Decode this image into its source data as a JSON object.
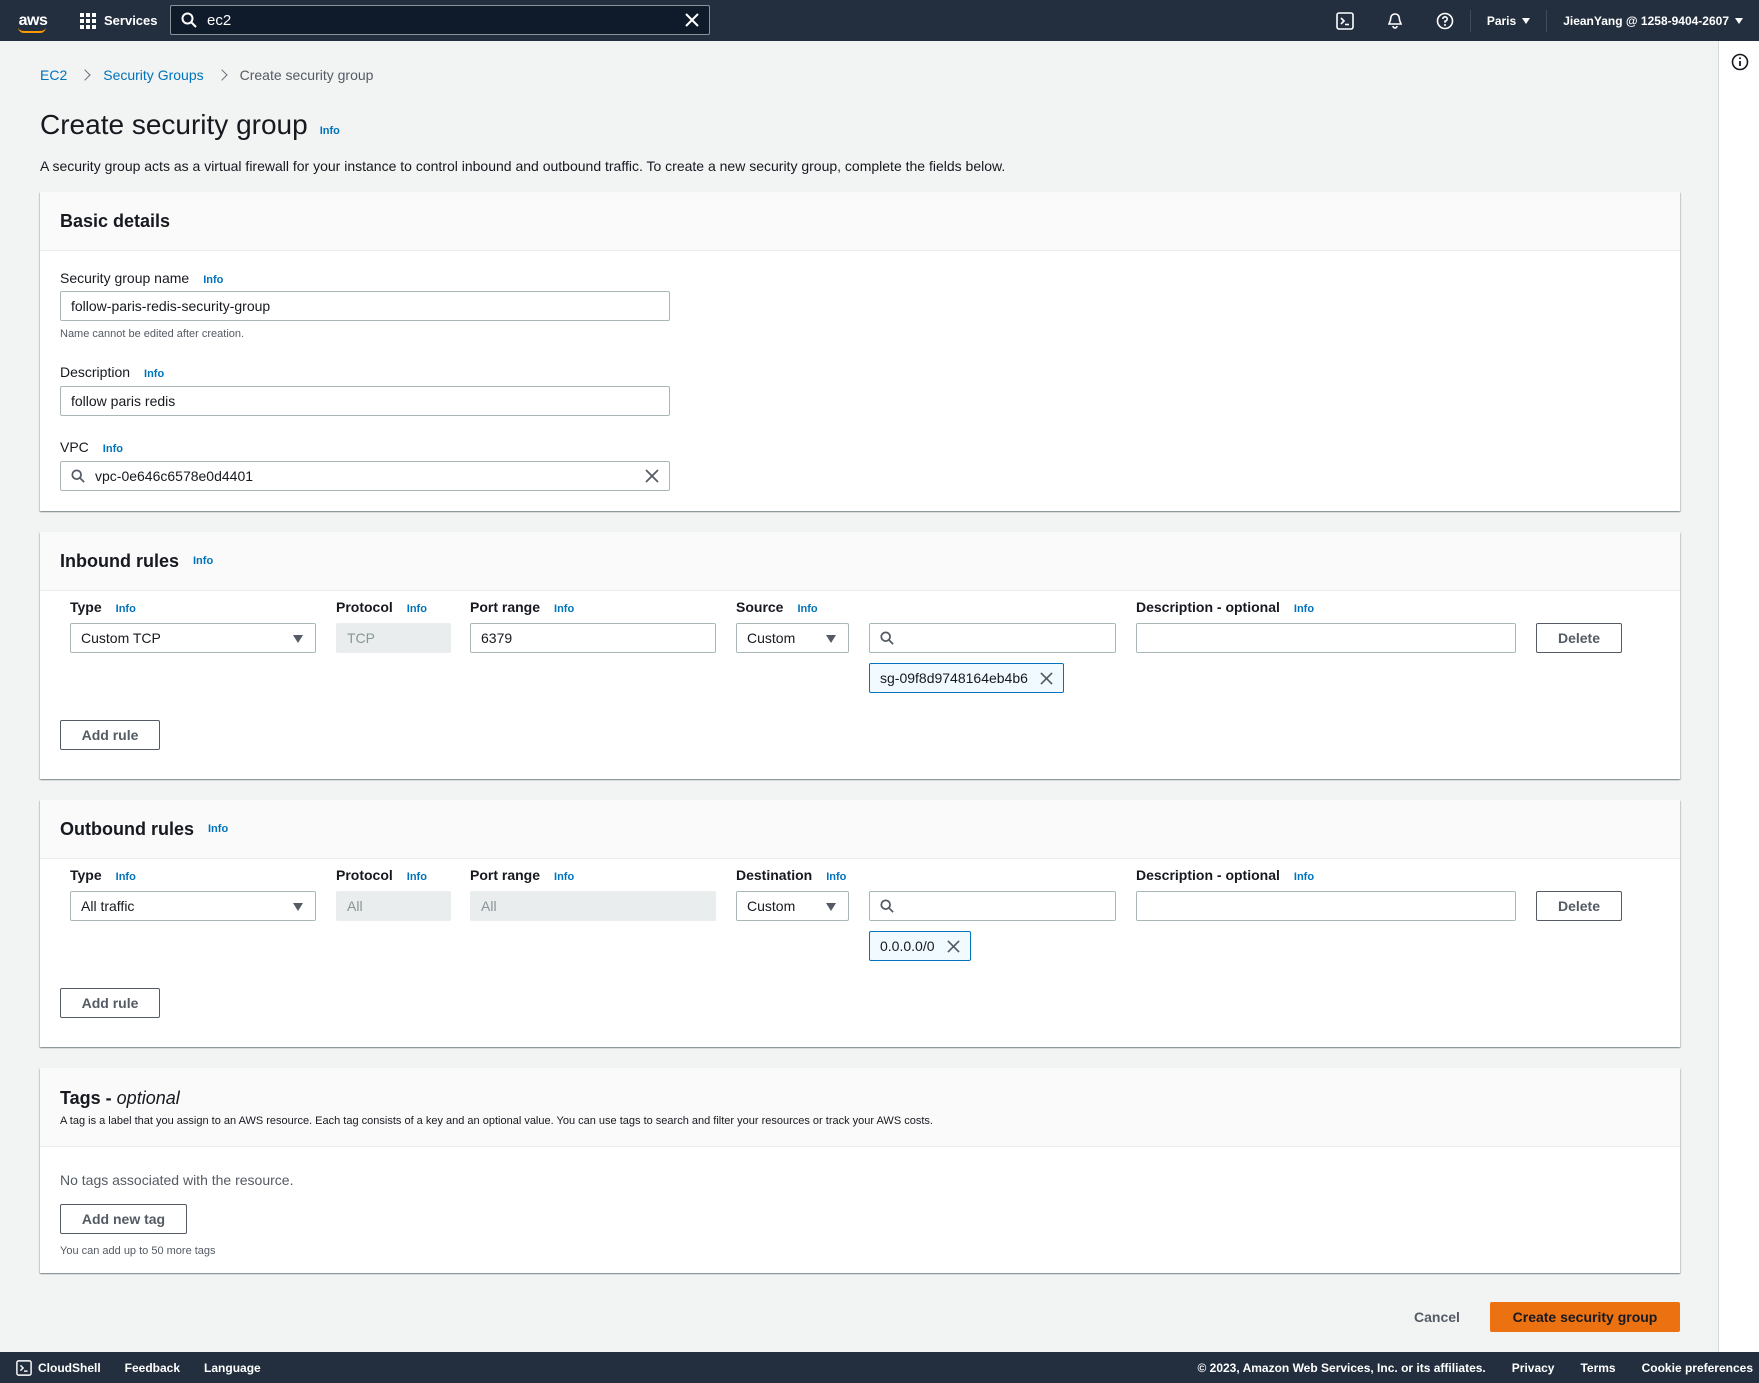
{
  "topnav": {
    "logo_text": "aws",
    "services_label": "Services",
    "search_value": "ec2",
    "region_label": "Paris",
    "account_label": "JieanYang @ 1258-9404-2607",
    "icons": [
      "cloudshell-icon",
      "bell-icon",
      "help-icon"
    ]
  },
  "breadcrumb": {
    "items": [
      "EC2",
      "Security Groups"
    ],
    "current": "Create security group"
  },
  "page": {
    "title": "Create security group",
    "info": "Info",
    "description": "A security group acts as a virtual firewall for your instance to control inbound and outbound traffic. To create a new security group, complete the fields below."
  },
  "basic_details": {
    "title": "Basic details",
    "name_label": "Security group name",
    "name_info": "Info",
    "name_value": "follow-paris-redis-security-group",
    "name_hint": "Name cannot be edited after creation.",
    "description_label": "Description",
    "description_info": "Info",
    "description_value": "follow paris redis",
    "vpc_label": "VPC",
    "vpc_info": "Info",
    "vpc_value": "vpc-0e646c6578e0d4401"
  },
  "inbound": {
    "title": "Inbound rules",
    "info": "Info",
    "col_type": "Type",
    "col_protocol": "Protocol",
    "col_port": "Port range",
    "col_source": "Source",
    "col_desc": "Description - optional",
    "info_label": "Info",
    "type_value": "Custom TCP",
    "protocol_value": "TCP",
    "port_value": "6379",
    "source_value": "Custom",
    "token_value": "sg-09f8d9748164eb4b6",
    "delete_label": "Delete",
    "add_rule_label": "Add rule"
  },
  "outbound": {
    "title": "Outbound rules",
    "info": "Info",
    "col_type": "Type",
    "col_protocol": "Protocol",
    "col_port": "Port range",
    "col_dest": "Destination",
    "col_desc": "Description - optional",
    "info_label": "Info",
    "type_value": "All traffic",
    "protocol_value": "All",
    "port_value": "All",
    "dest_value": "Custom",
    "token_value": "0.0.0.0/0",
    "delete_label": "Delete",
    "add_rule_label": "Add rule"
  },
  "tags": {
    "title": "Tags - ",
    "title_optional": "optional",
    "description": "A tag is a label that you assign to an AWS resource. Each tag consists of a key and an optional value. You can use tags to search and filter your resources or track your AWS costs.",
    "empty_text": "No tags associated with the resource.",
    "add_tag_label": "Add new tag",
    "hint": "You can add up to 50 more tags"
  },
  "actions": {
    "cancel_label": "Cancel",
    "create_label": "Create security group"
  },
  "bottombar": {
    "cloudshell": "CloudShell",
    "feedback": "Feedback",
    "language": "Language",
    "copyright": "© 2023, Amazon Web Services, Inc. or its affiliates.",
    "privacy": "Privacy",
    "terms": "Terms",
    "cookies": "Cookie preferences"
  },
  "colors": {
    "nav_bg": "#232f3e",
    "link": "#0073bb",
    "primary": "#ec7211",
    "page_bg": "#f2f3f3"
  }
}
